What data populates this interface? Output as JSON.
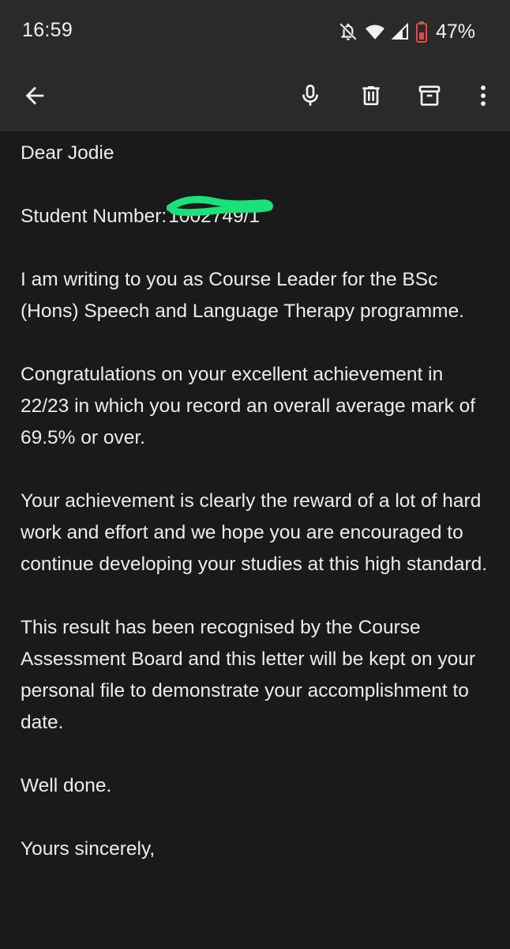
{
  "status_bar": {
    "time": "16:59",
    "battery_percent": "47%",
    "icons": [
      "notifications-off-icon",
      "wifi-icon",
      "cell-signal-icon",
      "battery-icon"
    ]
  },
  "app_bar": {
    "icons": [
      "back-arrow-icon",
      "microphone-icon",
      "delete-icon",
      "archive-icon",
      "more-vert-icon"
    ]
  },
  "letter": {
    "greeting": "Dear Jodie",
    "student_number_label": "Student Number:",
    "student_number_value": "1002749/1",
    "paragraphs": [
      "I am writing to you as Course Leader for the BSc (Hons) Speech and Language Therapy programme.",
      "Congratulations on your excellent achievement in 22/23 in which you record an overall average mark of 69.5% or over.",
      "Your achievement is clearly the reward of a lot of hard work and effort and we hope you are encouraged to continue developing your studies at this high standard.",
      "This result has been recognised by the Course Assessment Board and this letter will be kept on your personal file to demonstrate your accomplishment to date."
    ],
    "closing": "Well done.",
    "sign_off": "Yours sincerely,"
  },
  "colors": {
    "background": "#1a1a1a",
    "app_bar": "#2a2a2a",
    "text": "#ececec",
    "redaction": "#19e27a",
    "battery_low": "#e5484d"
  }
}
